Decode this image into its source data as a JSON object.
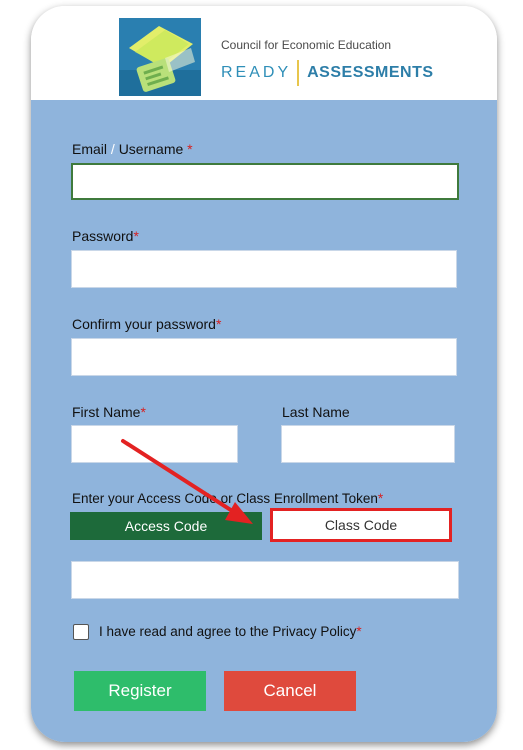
{
  "header": {
    "org_name": "Council for Economic Education",
    "brand_ready": "READY",
    "brand_assessments": "ASSESSMENTS"
  },
  "form": {
    "email_label_part1": "Email",
    "email_label_slash": "/",
    "email_label_part2": "Username",
    "required_mark": "*",
    "email_value": "",
    "password_label": "Password",
    "password_value": "",
    "confirm_label": "Confirm your password",
    "confirm_value": "",
    "first_name_label": "First Name",
    "first_name_value": "",
    "last_name_label": "Last Name",
    "last_name_value": "",
    "code_prompt": "Enter your Access Code or Class Enrollment Token",
    "tab_access": "Access Code",
    "tab_class": "Class Code",
    "code_value": "",
    "privacy_label": "I have read and agree to the Privacy Policy",
    "privacy_checked": false,
    "register_label": "Register",
    "cancel_label": "Cancel"
  },
  "colors": {
    "panel_bg": "#8fb4dc",
    "access_tab": "#1d6a3a",
    "register_btn": "#2ebd6b",
    "cancel_btn": "#df4a3d",
    "highlight_red": "#e32222",
    "required_red": "#d62020"
  },
  "icons": {
    "logo": "ready-assessments-logo-icon",
    "annotation": "red-arrow-icon"
  }
}
